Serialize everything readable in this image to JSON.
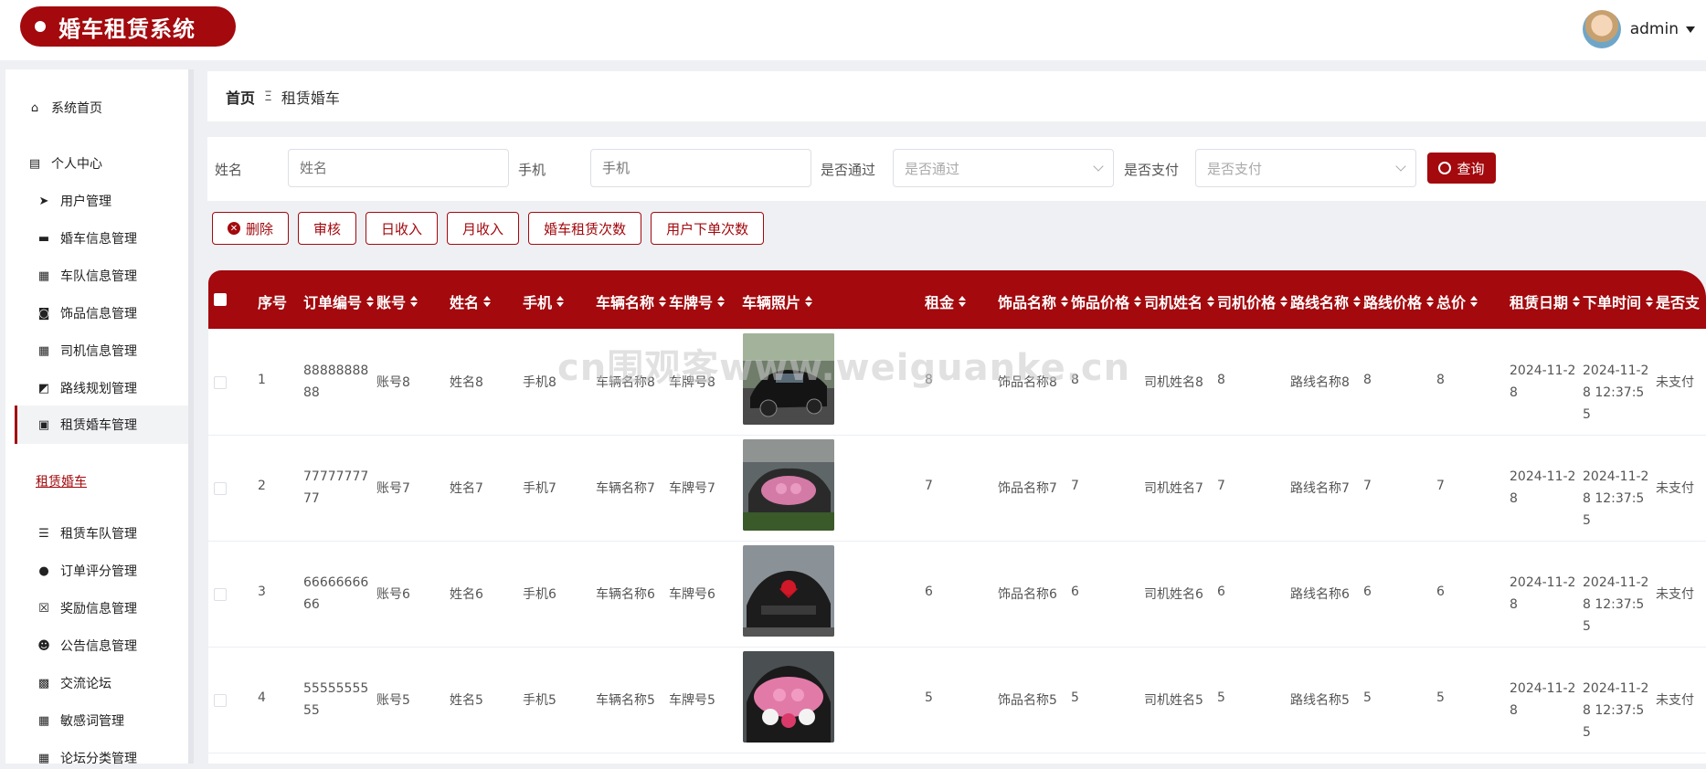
{
  "app": {
    "title": "婚车租赁系统",
    "user": "admin"
  },
  "sidebar": {
    "items": [
      {
        "label": "系统首页",
        "icon": "home-icon"
      },
      {
        "label": "个人中心",
        "icon": "calendar-icon"
      },
      {
        "label": "用户管理",
        "icon": "send-icon"
      },
      {
        "label": "婚车信息管理",
        "icon": "monitor-icon"
      },
      {
        "label": "车队信息管理",
        "icon": "grid-icon"
      },
      {
        "label": "饰品信息管理",
        "icon": "camera-icon"
      },
      {
        "label": "司机信息管理",
        "icon": "grid-icon"
      },
      {
        "label": "路线规划管理",
        "icon": "chart-icon"
      },
      {
        "label": "租赁婚车管理",
        "icon": "clipboard-icon"
      },
      {
        "label": "租赁车队管理",
        "icon": "list-icon"
      },
      {
        "label": "订单评分管理",
        "icon": "pin-icon"
      },
      {
        "label": "奖励信息管理",
        "icon": "file-x-icon"
      },
      {
        "label": "公告信息管理",
        "icon": "person-icon"
      },
      {
        "label": "交流论坛",
        "icon": "briefcase-icon"
      },
      {
        "label": "敏感词管理",
        "icon": "grid-icon"
      },
      {
        "label": "论坛分类管理",
        "icon": "grid-icon"
      }
    ],
    "sub_item": "租赁婚车"
  },
  "breadcrumb": {
    "home": "首页",
    "separator": "Ξ",
    "current": "租赁婚车"
  },
  "search": {
    "name_label": "姓名",
    "name_placeholder": "姓名",
    "phone_label": "手机",
    "phone_placeholder": "手机",
    "approved_label": "是否通过",
    "approved_placeholder": "是否通过",
    "paid_label": "是否支付",
    "paid_placeholder": "是否支付",
    "query_button": "查询"
  },
  "actions": [
    "删除",
    "审核",
    "日收入",
    "月收入",
    "婚车租赁次数",
    "用户下单次数"
  ],
  "table": {
    "headers": [
      "序号",
      "订单编号",
      "账号",
      "姓名",
      "手机",
      "车辆名称",
      "车牌号",
      "车辆照片",
      "租金",
      "饰品名称",
      "饰品价格",
      "司机姓名",
      "司机价格",
      "路线名称",
      "路线价格",
      "总价",
      "租赁日期",
      "下单时间",
      "是否支"
    ],
    "rows": [
      {
        "no": "1",
        "order": "8888888888",
        "account": "账号8",
        "name": "姓名8",
        "phone": "手机8",
        "car": "车辆名称8",
        "plate": "车牌号8",
        "rent": "8",
        "deco": "饰品名称8",
        "deco_price": "8",
        "driver": "司机姓名8",
        "driver_price": "8",
        "route": "路线名称8",
        "route_price": "8",
        "total": "8",
        "date": "2024-11-28",
        "time": "2024-11-28 12:37:55",
        "paid": "未支付"
      },
      {
        "no": "2",
        "order": "7777777777",
        "account": "账号7",
        "name": "姓名7",
        "phone": "手机7",
        "car": "车辆名称7",
        "plate": "车牌号7",
        "rent": "7",
        "deco": "饰品名称7",
        "deco_price": "7",
        "driver": "司机姓名7",
        "driver_price": "7",
        "route": "路线名称7",
        "route_price": "7",
        "total": "7",
        "date": "2024-11-28",
        "time": "2024-11-28 12:37:55",
        "paid": "未支付"
      },
      {
        "no": "3",
        "order": "6666666666",
        "account": "账号6",
        "name": "姓名6",
        "phone": "手机6",
        "car": "车辆名称6",
        "plate": "车牌号6",
        "rent": "6",
        "deco": "饰品名称6",
        "deco_price": "6",
        "driver": "司机姓名6",
        "driver_price": "6",
        "route": "路线名称6",
        "route_price": "6",
        "total": "6",
        "date": "2024-11-28",
        "time": "2024-11-28 12:37:55",
        "paid": "未支付"
      },
      {
        "no": "4",
        "order": "5555555555",
        "account": "账号5",
        "name": "姓名5",
        "phone": "手机5",
        "car": "车辆名称5",
        "plate": "车牌号5",
        "rent": "5",
        "deco": "饰品名称5",
        "deco_price": "5",
        "driver": "司机姓名5",
        "driver_price": "5",
        "route": "路线名称5",
        "route_price": "5",
        "total": "5",
        "date": "2024-11-28",
        "time": "2024-11-28 12:37:55",
        "paid": "未支付"
      }
    ]
  },
  "watermark": "cn围观客www.weiguanke.cn",
  "colors": {
    "primary": "#a3090d"
  }
}
